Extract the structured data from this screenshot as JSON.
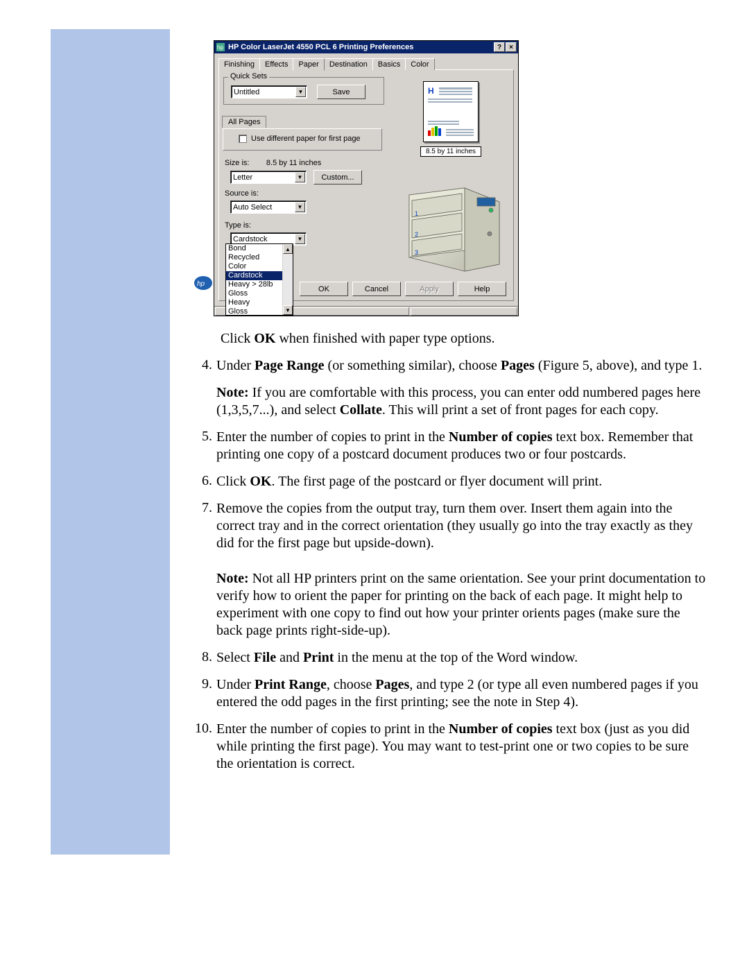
{
  "dialog": {
    "title": "HP Color LaserJet 4550 PCL 6 Printing Preferences",
    "tabs": {
      "finishing": "Finishing",
      "effects": "Effects",
      "paper": "Paper",
      "destination": "Destination",
      "basics": "Basics",
      "color": "Color"
    },
    "quick_sets": {
      "legend": "Quick Sets",
      "value": "Untitled",
      "save": "Save"
    },
    "all_pages_tab": "All Pages",
    "use_diff_paper": "Use different paper for first page",
    "size_label": "Size is:",
    "size_value": "8.5 by 11 inches",
    "size_select": "Letter",
    "custom_button": "Custom...",
    "source_label": "Source is:",
    "source_select": "Auto Select",
    "type_label": "Type is:",
    "type_select": "Cardstock",
    "type_options": [
      "Bond",
      "Recycled",
      "Color",
      "Cardstock",
      "Heavy > 28lb",
      "Gloss",
      "Heavy Gloss"
    ],
    "type_options_lines": [
      "Bond",
      "Recycled",
      "Color",
      "Cardstock",
      "Heavy > 28lb",
      "Gloss",
      "Heavy",
      "Gloss"
    ],
    "preview_size": "8.5 by 11 inches",
    "buttons": {
      "ok": "OK",
      "cancel": "Cancel",
      "apply": "Apply",
      "help": "Help"
    },
    "tray_labels": {
      "one": "1",
      "two": "2",
      "three": "3"
    }
  },
  "doc": {
    "intro_before": "Click ",
    "intro_bold": "OK",
    "intro_after": " when finished with paper type options.",
    "items": {
      "4": {
        "num": "4.",
        "p1_a": "Under ",
        "p1_b": "Page Range",
        "p1_c": " (or something similar), choose ",
        "p1_d": "Pages",
        "p1_e": " (Figure 5, above), and type 1.",
        "p2_a": "Note:",
        "p2_b": " If you are comfortable with this process, you can enter odd numbered pages here (1,3,5,7...), and select ",
        "p2_c": "Collate",
        "p2_d": ". This will print a set of front pages for each copy."
      },
      "5": {
        "num": "5.",
        "p_a": "Enter the number of copies to print in the ",
        "p_b": "Number of copies",
        "p_c": " text box. Remember that printing one copy of a postcard document produces two or four postcards."
      },
      "6": {
        "num": "6.",
        "p_a": "Click ",
        "p_b": "OK",
        "p_c": ". The first page of the postcard or flyer document will print."
      },
      "7": {
        "num": "7.",
        "p1": "Remove the copies from the output tray, turn them over. Insert them again into the correct tray and in the correct orientation (they usually go into the tray exactly as they did for the first page but upside-down).",
        "p2_a": "Note:",
        "p2_b": " Not all HP printers print on the same orientation. See your print documentation to verify how to orient the paper for printing on the back of each page. It might help to experiment with one copy to find out how your printer orients pages (make sure the back page prints right-side-up)."
      },
      "8": {
        "num": "8.",
        "p_a": "Select ",
        "p_b": "File",
        "p_c": " and ",
        "p_d": "Print",
        "p_e": " in the menu at the top of the Word window."
      },
      "9": {
        "num": "9.",
        "p_a": "Under ",
        "p_b": "Print Range",
        "p_c": ", choose ",
        "p_d": "Pages",
        "p_e": ", and type 2 (or type all even numbered pages if you entered the odd pages in the first printing; see the note in Step 4)."
      },
      "10": {
        "num": "10.",
        "p_a": "Enter the number of copies to print in the ",
        "p_b": "Number of copies",
        "p_c": " text box (just as you did while printing the first page). You may want to test-print one or two copies to be sure the orientation is correct."
      }
    }
  }
}
